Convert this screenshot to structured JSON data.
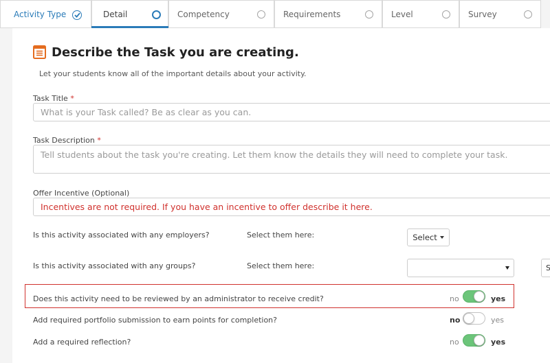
{
  "tabs": [
    {
      "label": "Activity Type",
      "state": "done"
    },
    {
      "label": "Detail",
      "state": "active"
    },
    {
      "label": "Competency",
      "state": "todo"
    },
    {
      "label": "Requirements",
      "state": "todo"
    },
    {
      "label": "Level",
      "state": "todo"
    },
    {
      "label": "Survey",
      "state": "todo"
    }
  ],
  "header": {
    "title": "Describe the Task you are creating.",
    "subtitle": "Let your students know all of the important details about your activity."
  },
  "task_title": {
    "label": "Task Title",
    "required_mark": "*",
    "placeholder": "What is your Task called? Be as clear as you can."
  },
  "task_description": {
    "label": "Task Description",
    "required_mark": "*",
    "placeholder": "Tell students about the task you're creating. Let them know the details they will need to complete your task."
  },
  "incentive": {
    "label": "Offer Incentive (Optional)",
    "placeholder": "Incentives are not required. If you have an incentive to offer describe it here."
  },
  "employers": {
    "question": "Is this activity associated with any employers?",
    "select_hint": "Select them here:",
    "button_label": "Select"
  },
  "groups": {
    "question": "Is this activity associated with any groups?",
    "select_hint": "Select them here:",
    "selected_value": "",
    "side_button_label": "S"
  },
  "toggles": [
    {
      "question": "Does this activity need to be reviewed by an administrator to receive credit?",
      "no": "no",
      "yes": "yes",
      "value": true,
      "highlighted": true
    },
    {
      "question": "Add required portfolio submission to earn points for completion?",
      "no": "no",
      "yes": "yes",
      "value": false,
      "highlighted": false
    },
    {
      "question": "Add a required reflection?",
      "no": "no",
      "yes": "yes",
      "value": true,
      "highlighted": false
    }
  ],
  "colors": {
    "accent": "#2a7bb8",
    "required": "#d0312d",
    "toggle_on": "#6cc57a",
    "highlight_border": "#d0312d"
  }
}
